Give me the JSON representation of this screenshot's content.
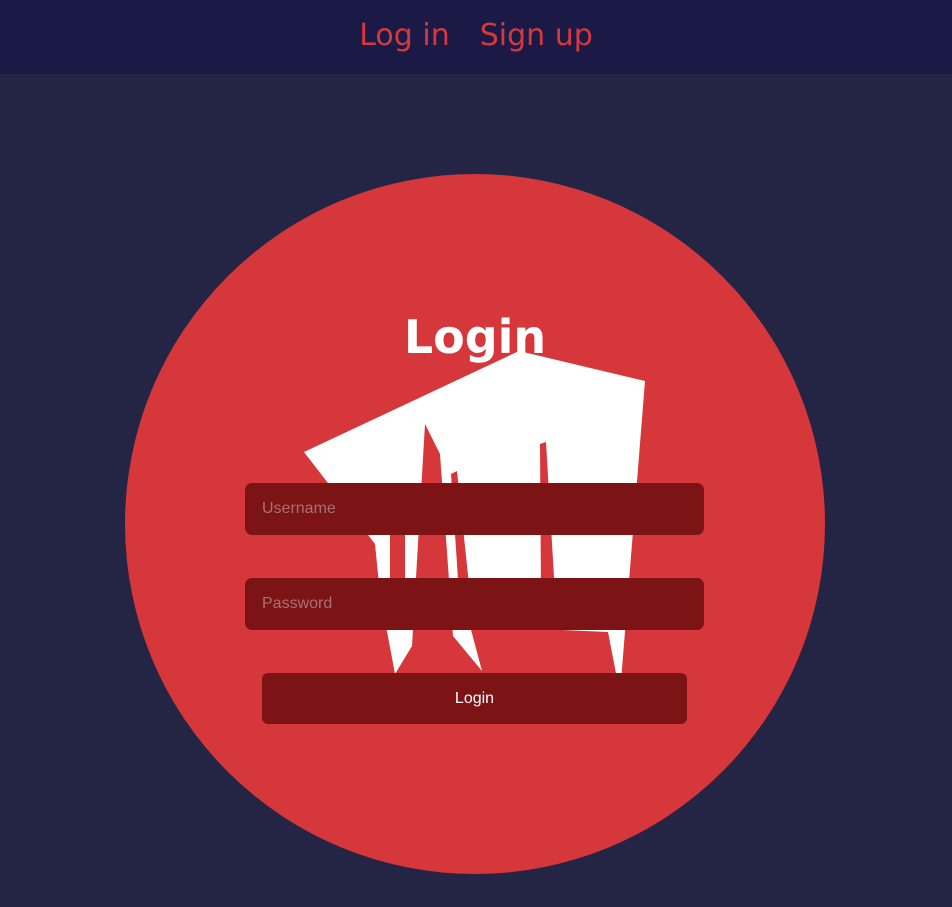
{
  "nav": {
    "login_label": "Log in",
    "signup_label": "Sign up"
  },
  "form": {
    "title": "Login",
    "username_placeholder": "Username",
    "password_placeholder": "Password",
    "submit_label": "Login"
  },
  "logo": {
    "icon": "fist-logo-icon"
  },
  "colors": {
    "page_background": "#242444",
    "navbar_background": "#1b1a46",
    "accent": "#d5373b",
    "field_background": "#7c1416",
    "text_light": "#ffffff"
  }
}
